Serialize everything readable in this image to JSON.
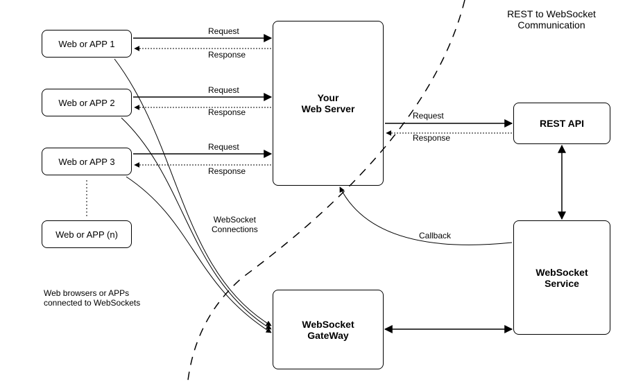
{
  "title": "REST to WebSocket Communication",
  "clients": {
    "c1": "Web or APP 1",
    "c2": "Web or APP 2",
    "c3": "Web or APP 3",
    "cn": "Web or APP (n)"
  },
  "nodes": {
    "server": "Your\nWeb Server",
    "rest": "REST API",
    "wsservice": "WebSocket\nService",
    "wsgateway": "WebSocket\nGateWay"
  },
  "labels": {
    "request": "Request",
    "response": "Response",
    "wsconn": "WebSocket\nConnections",
    "callback": "Callback",
    "clientsNote": "Web browsers or APPs\nconnected to WebSockets"
  }
}
